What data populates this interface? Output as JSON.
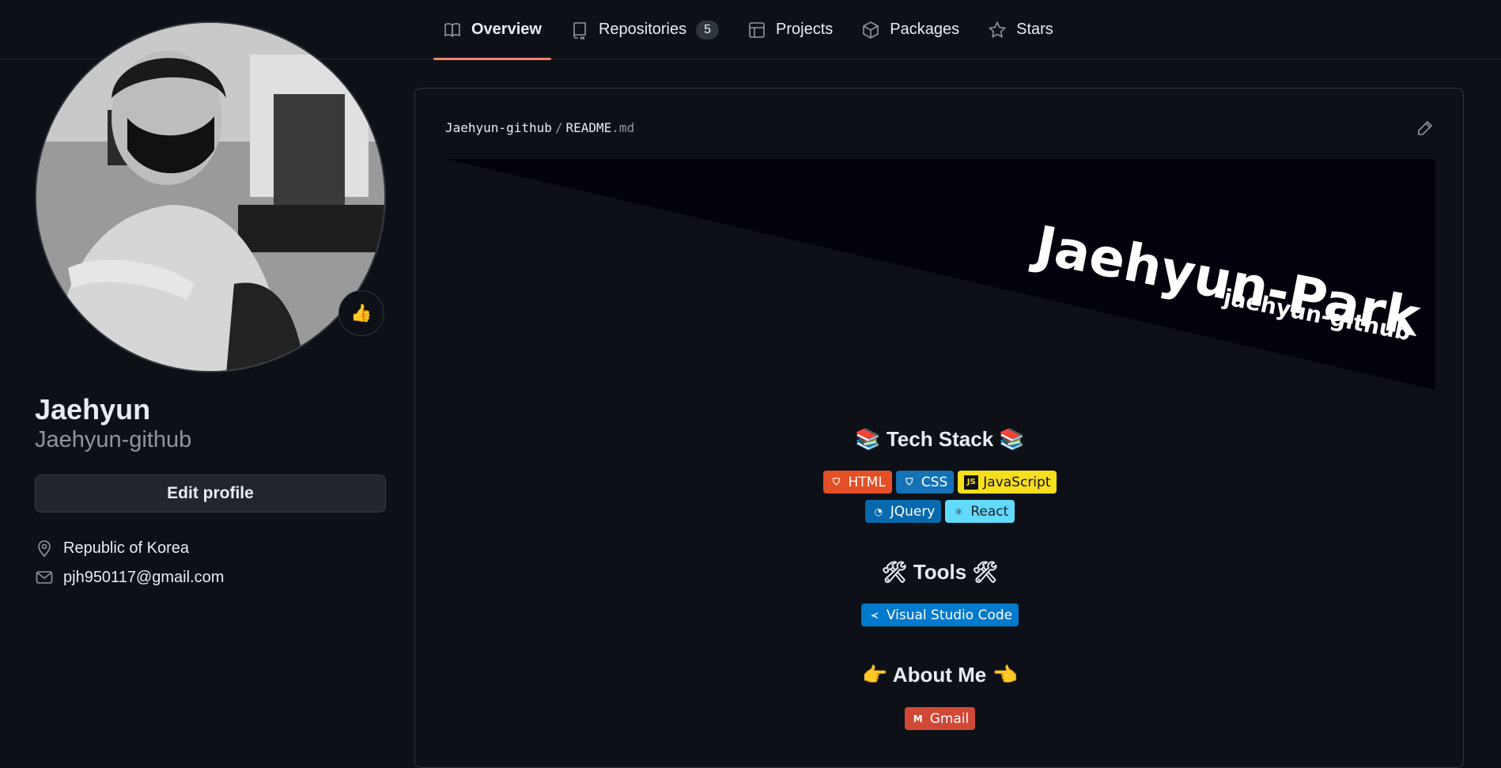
{
  "nav": {
    "tabs": [
      {
        "label": "Overview",
        "active": true,
        "icon": "book-icon"
      },
      {
        "label": "Repositories",
        "count": "5",
        "icon": "repo-icon"
      },
      {
        "label": "Projects",
        "icon": "table-icon"
      },
      {
        "label": "Packages",
        "icon": "package-icon"
      },
      {
        "label": "Stars",
        "icon": "star-icon"
      }
    ]
  },
  "profile": {
    "status_emoji": "👍",
    "name": "Jaehyun",
    "login": "Jaehyun-github",
    "edit_label": "Edit profile",
    "location": "Republic of Korea",
    "email": "pjh950117@gmail.com"
  },
  "readme": {
    "owner": "Jaehyun-github",
    "separator": "/",
    "file": "README",
    "ext": ".md",
    "banner_title": "Jaehyun-Park",
    "banner_subtitle": "jaehyun-github",
    "tech_title": "📚 Tech Stack 📚",
    "tech_badges_row1": [
      {
        "label": "HTML",
        "color": "#e34f26"
      },
      {
        "label": "CSS",
        "color": "#1572b6"
      },
      {
        "label": "JavaScript",
        "color": "#f7df1e"
      }
    ],
    "tech_badges_row2": [
      {
        "label": "JQuery",
        "color": "#0769ad"
      },
      {
        "label": "React",
        "color": "#61dafb"
      }
    ],
    "tools_title": "🛠 Tools 🛠",
    "tools_badges": [
      {
        "label": "Visual Studio Code",
        "color": "#007acc"
      }
    ],
    "about_title": "👉 About Me 👈",
    "about_badges": [
      {
        "label": "Gmail",
        "color": "#d14836"
      }
    ]
  },
  "colors": {
    "background": "#0d1117",
    "accent_underline": "#f78166",
    "border": "#30363d",
    "muted_text": "#8d96a0"
  }
}
